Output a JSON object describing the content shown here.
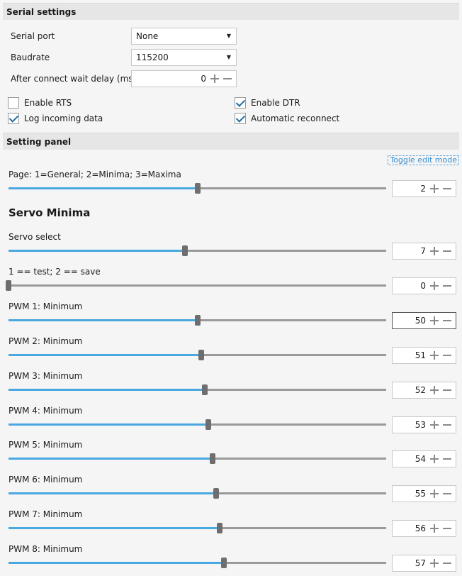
{
  "serial": {
    "header": "Serial settings",
    "port_label": "Serial port",
    "port_value": "None",
    "baud_label": "Baudrate",
    "baud_value": "115200",
    "delay_label": "After connect wait delay (ms)",
    "delay_value": "0",
    "rts_label": "Enable RTS",
    "rts_checked": false,
    "dtr_label": "Enable DTR",
    "dtr_checked": true,
    "log_label": "Log incoming data",
    "log_checked": true,
    "reconnect_label": "Automatic reconnect",
    "reconnect_checked": true
  },
  "panel": {
    "header": "Setting panel",
    "toggle_link": "Toggle edit mode",
    "page_label": "Page: 1=General; 2=Minima; 3=Maxima",
    "page_value": "2",
    "page_slider_fraction": 0.5,
    "section_title": "Servo Minima",
    "rows": [
      {
        "label": "Servo select",
        "value": "7",
        "fraction": 0.468
      },
      {
        "label": "1 == test;  2 == save",
        "value": "0",
        "fraction": 0.0
      },
      {
        "label": "PWM 1: Minimum",
        "value": "50",
        "fraction": 0.5
      },
      {
        "label": "PWM 2: Minimum",
        "value": "51",
        "fraction": 0.51
      },
      {
        "label": "PWM 3: Minimum",
        "value": "52",
        "fraction": 0.52
      },
      {
        "label": "PWM 4: Minimum",
        "value": "53",
        "fraction": 0.53
      },
      {
        "label": "PWM 5: Minimum",
        "value": "54",
        "fraction": 0.54
      },
      {
        "label": "PWM 6: Minimum",
        "value": "55",
        "fraction": 0.55
      },
      {
        "label": "PWM 7: Minimum",
        "value": "56",
        "fraction": 0.56
      },
      {
        "label": "PWM 8: Minimum",
        "value": "57",
        "fraction": 0.57
      }
    ]
  },
  "colors": {
    "accent": "#4aa8e0",
    "checkmark": "#1e6fa6"
  }
}
